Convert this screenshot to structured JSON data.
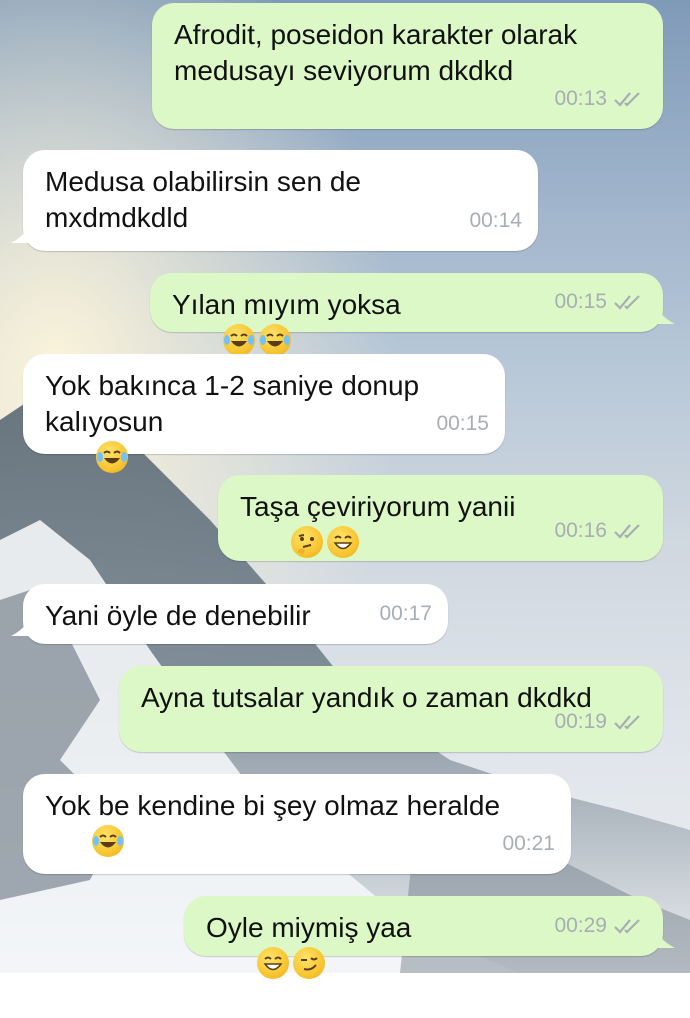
{
  "messages": [
    {
      "direction": "out",
      "text": "Afrodit, poseidon karakter olarak medusayı seviyorum dkdkd",
      "time": "00:13",
      "read": true
    },
    {
      "direction": "in",
      "text": "Medusa olabilirsin sen de mxdmdkdld",
      "time": "00:14"
    },
    {
      "direction": "out",
      "text": "Yılan mıyım yoksa",
      "emojis": [
        "laughing-tears",
        "laughing-tears"
      ],
      "time": "00:15",
      "read": true
    },
    {
      "direction": "in",
      "text": "Yok bakınca 1-2 saniye donup kalıyosun",
      "emojis": [
        "laughing-tears"
      ],
      "time": "00:15"
    },
    {
      "direction": "out",
      "text": "Taşa çeviriyorum yanii",
      "emojis": [
        "thinking",
        "grinning"
      ],
      "time": "00:16",
      "read": true
    },
    {
      "direction": "in",
      "text": "Yani öyle de denebilir",
      "time": "00:17"
    },
    {
      "direction": "out",
      "text": "Ayna tutsalar yandık o zaman dkdkd",
      "time": "00:19",
      "read": true
    },
    {
      "direction": "in",
      "text": "Yok be kendine bi şey olmaz heralde",
      "emojis": [
        "laughing-tears"
      ],
      "time": "00:21"
    },
    {
      "direction": "out",
      "text": "Oyle miymiş yaa",
      "emojis": [
        "grinning",
        "smirking"
      ],
      "time": "00:29",
      "read": true
    }
  ],
  "colors": {
    "outgoing": "#dcf8c6",
    "incoming": "#ffffff",
    "tick": "#a7aeb4"
  }
}
